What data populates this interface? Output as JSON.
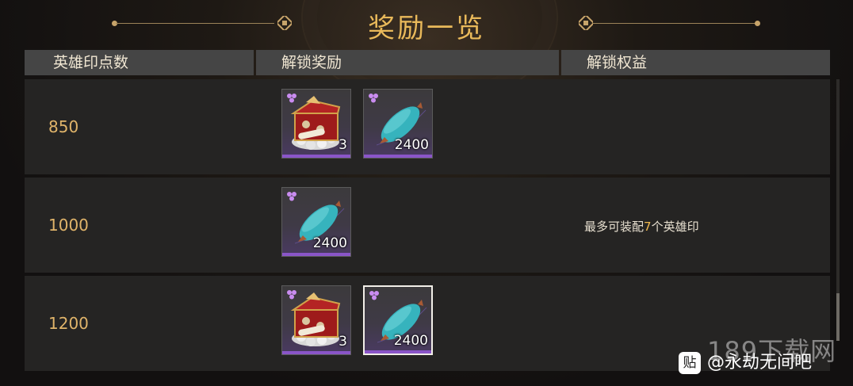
{
  "title": "奖励一览",
  "headers": {
    "points": "英雄印点数",
    "rewards": "解锁奖励",
    "benefits": "解锁权益"
  },
  "rows": [
    {
      "points": "850",
      "items": [
        {
          "kind": "chest",
          "count": "3",
          "icon": "treasure-chest-icon"
        },
        {
          "kind": "cocoon",
          "count": "2400",
          "icon": "cocoon-icon"
        }
      ],
      "benefit": {
        "pre": "",
        "highlight": "",
        "post": ""
      }
    },
    {
      "points": "1000",
      "items": [
        {
          "kind": "cocoon",
          "count": "2400",
          "icon": "cocoon-icon"
        }
      ],
      "benefit": {
        "pre": "最多可装配",
        "highlight": "7",
        "post": "个英雄印"
      }
    },
    {
      "points": "1200",
      "items": [
        {
          "kind": "chest",
          "count": "3",
          "icon": "treasure-chest-icon"
        },
        {
          "kind": "cocoon",
          "count": "2400",
          "icon": "cocoon-icon",
          "selected": true
        }
      ],
      "benefit": {
        "pre": "",
        "highlight": "",
        "post": ""
      }
    }
  ],
  "colors": {
    "title": "#e9b95a",
    "points": "#e0b46a",
    "highlight": "#f0b84c",
    "rarity": "#8a55c8"
  },
  "watermark": {
    "site": "189下载网",
    "tieba_logo": "贴",
    "tieba": "@永劫无间吧"
  }
}
